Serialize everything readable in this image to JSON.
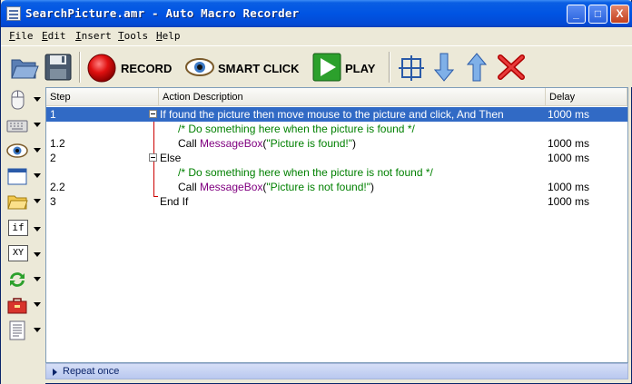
{
  "window": {
    "title": "SearchPicture.amr - Auto Macro Recorder"
  },
  "title_buttons": {
    "minimize": "_",
    "maximize": "□",
    "close": "X"
  },
  "menu": [
    {
      "underline": "F",
      "rest": "ile"
    },
    {
      "underline": "E",
      "rest": "dit"
    },
    {
      "underline": "I",
      "rest": "nsert"
    },
    {
      "underline": "T",
      "rest": "ools"
    },
    {
      "underline": "H",
      "rest": "elp"
    }
  ],
  "toolbar": {
    "record_label": "RECORD",
    "smart_click_label": "SMART CLICK",
    "play_label": "PLAY"
  },
  "sidebar": {
    "if_label": "if",
    "xy_label": "XY"
  },
  "grid": {
    "columns": [
      "Step",
      "Action Description",
      "Delay"
    ],
    "rows": [
      {
        "step": "1",
        "desc": "If found the picture then move mouse to the picture and click, And Then",
        "delay": "1000 ms"
      },
      {
        "step": "",
        "desc": "/* Do something here when the picture is found */",
        "delay": ""
      },
      {
        "step": "1.2",
        "call": "Call ",
        "fn": "MessageBox",
        "open": "(",
        "str": "\"Picture is found!\"",
        "close": ")",
        "delay": "1000 ms"
      },
      {
        "step": "2",
        "desc": "Else",
        "delay": "1000 ms"
      },
      {
        "step": "",
        "desc": "/* Do something here when the picture is not found */",
        "delay": ""
      },
      {
        "step": "2.2",
        "call": "Call ",
        "fn": "MessageBox",
        "open": "(",
        "str": "\"Picture is not found!\"",
        "close": ")",
        "delay": "1000 ms"
      },
      {
        "step": "3",
        "desc": "End If",
        "delay": "1000 ms"
      }
    ]
  },
  "status": {
    "repeat_label": "Repeat once"
  },
  "colors": {
    "selection": "#316ac5",
    "comment": "#008000",
    "function": "#800080",
    "tree_line": "#cc0000"
  }
}
